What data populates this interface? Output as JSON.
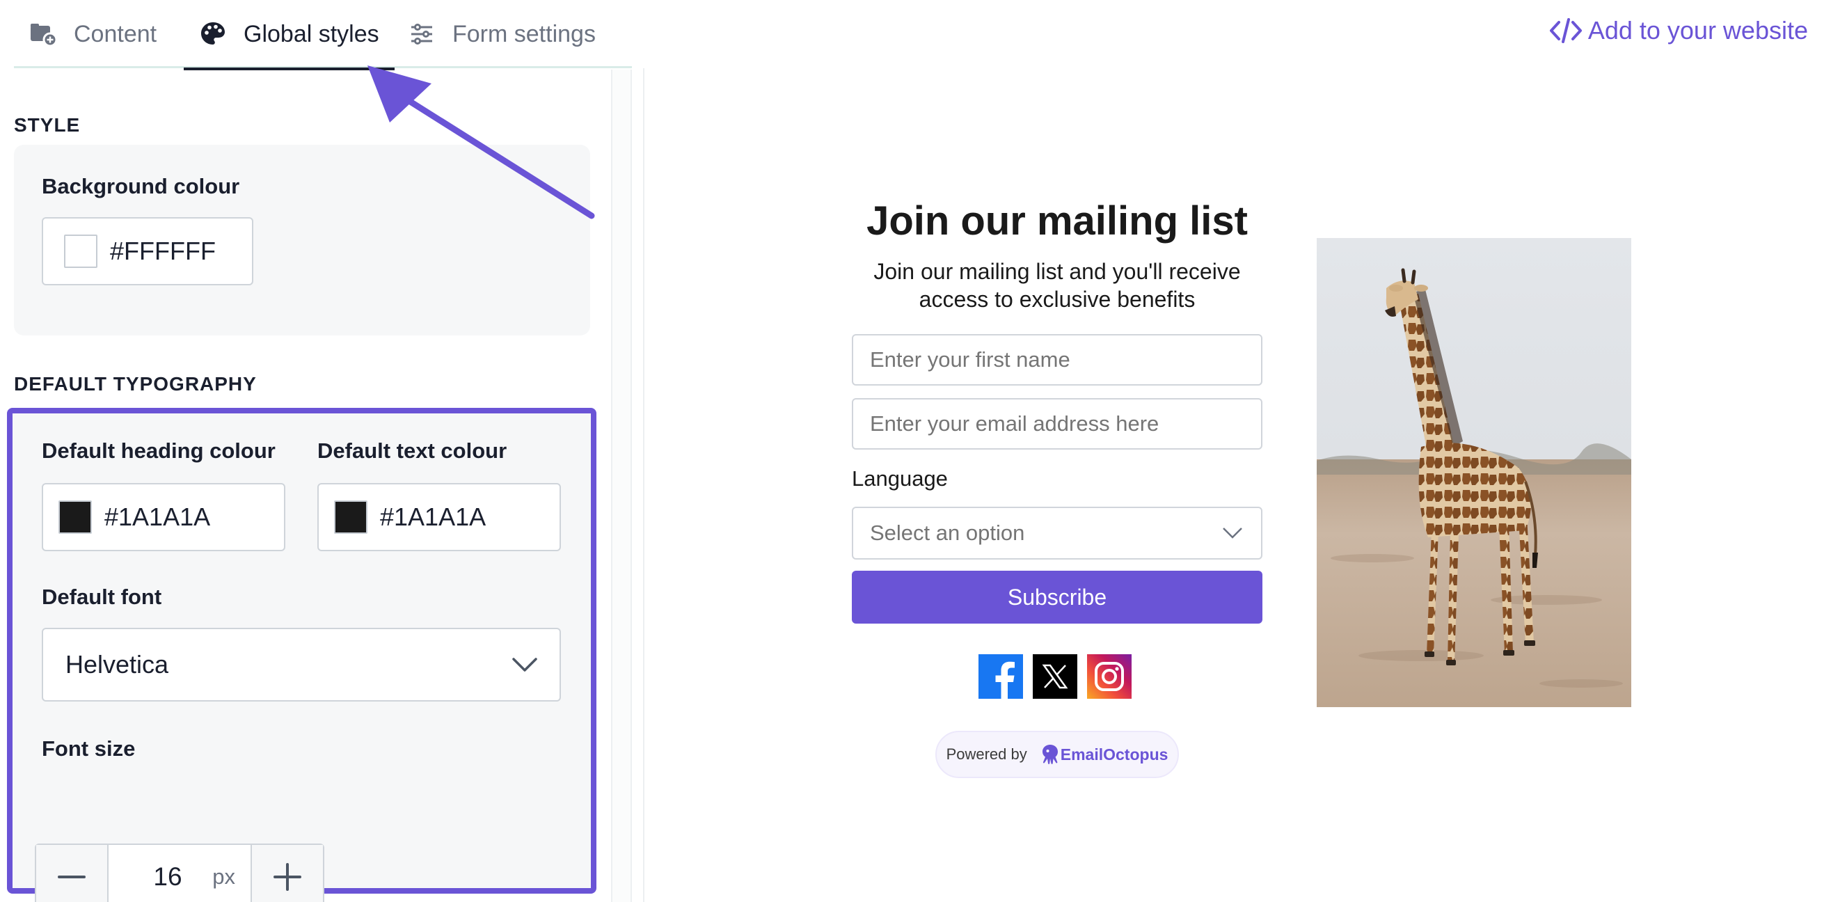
{
  "tabs": [
    {
      "label": "Content",
      "icon": "folder-plus-icon"
    },
    {
      "label": "Global styles",
      "icon": "palette-icon"
    },
    {
      "label": "Form settings",
      "icon": "sliders-icon"
    }
  ],
  "header": {
    "add_to_website": "Add to your website"
  },
  "style": {
    "title": "STYLE",
    "background_label": "Background colour",
    "background_value": "#FFFFFF"
  },
  "typography": {
    "title": "DEFAULT TYPOGRAPHY",
    "heading_colour_label": "Default heading colour",
    "heading_colour_value": "#1A1A1A",
    "text_colour_label": "Default text colour",
    "text_colour_value": "#1A1A1A",
    "font_label": "Default font",
    "font_value": "Helvetica",
    "font_size_label": "Font size",
    "font_size_value": "16",
    "font_size_unit": "px"
  },
  "preview": {
    "heading": "Join our mailing list",
    "subtitle": "Join our mailing list and you'll receive access to exclusive benefits",
    "first_name_placeholder": "Enter your first name",
    "email_placeholder": "Enter your email address here",
    "language_label": "Language",
    "language_placeholder": "Select an option",
    "subscribe_label": "Subscribe",
    "powered_by": "Powered by",
    "brand": "EmailOctopus"
  },
  "colors": {
    "accent": "#6A54D6",
    "text": "#1A1A1A",
    "background": "#FFFFFF"
  }
}
